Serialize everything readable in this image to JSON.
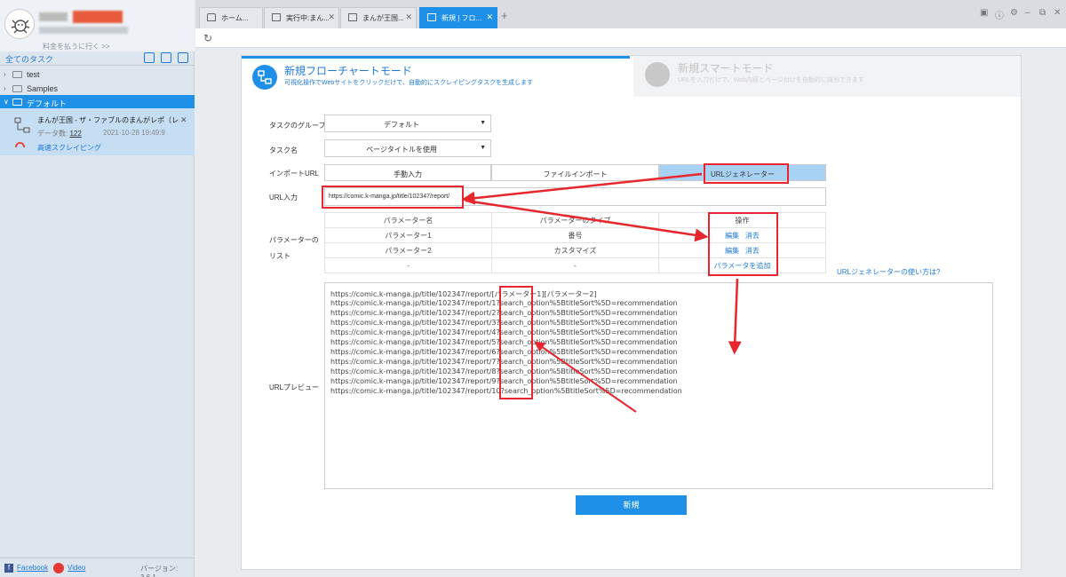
{
  "sidebar": {
    "pay_link": "料金を払うに行く >>",
    "all_tasks": "全てのタスク",
    "tree": [
      {
        "label": "test"
      },
      {
        "label": "Samples"
      },
      {
        "label": "デフォルト"
      }
    ],
    "task": {
      "title": "まんが王国 - ザ・ファブルのまんがレポ（レ...",
      "count_label": "データ数:",
      "count": "122",
      "date": "2021-10-28 19:49:9",
      "speed_label": "高速スクレイピング"
    },
    "footer": {
      "facebook": "Facebook",
      "video": "Video",
      "version": "バージョン: 3.6.1"
    }
  },
  "tabs": [
    {
      "label": "ホーム..."
    },
    {
      "label": "実行中:まん..."
    },
    {
      "label": "まんが王国..."
    },
    {
      "label": "新規 | フロ..."
    }
  ],
  "modes": {
    "flow_title": "新規フローチャートモード",
    "flow_sub": "可視化操作でWebサイトをクリックだけで、自動的にスクレイピングタスクを生成します",
    "smart_title": "新規スマートモード",
    "smart_sub": "URLを入力だけで、Web内容とページ付けを自動的に識別できます"
  },
  "form": {
    "group_label": "タスクのグループ",
    "group_value": "デフォルト",
    "name_label": "タスク名",
    "name_value": "ページタイトルを使用",
    "import_label": "インポートURL",
    "import_tabs": [
      "手動入力",
      "ファイルインポート",
      "URLジェネレーター"
    ],
    "url_label": "URL入力",
    "url_value": "https://comic.k-manga.jp/title/102347/report/",
    "param_label": "パラメーターのリスト",
    "param_headers": [
      "パラメーター名",
      "パラメーターのタイプ",
      "操作"
    ],
    "params": [
      {
        "name": "パラメーター1",
        "type": "番号",
        "edit": "編集",
        "delete": "消去"
      },
      {
        "name": "パラメーター2",
        "type": "カスタマイズ",
        "edit": "編集",
        "delete": "消去"
      }
    ],
    "empty_cell": "-",
    "add_param": "パラメータを追加",
    "help_link": "URLジェネレーターの使い方は?",
    "preview_label": "URLプレビュー",
    "preview_lines": [
      "https://comic.k-manga.jp/title/102347/report/[パラメーター1][パラメーター2]",
      "https://comic.k-manga.jp/title/102347/report/1?search_option%5BtitleSort%5D=recommendation",
      "https://comic.k-manga.jp/title/102347/report/2?search_option%5BtitleSort%5D=recommendation",
      "https://comic.k-manga.jp/title/102347/report/3?search_option%5BtitleSort%5D=recommendation",
      "https://comic.k-manga.jp/title/102347/report/4?search_option%5BtitleSort%5D=recommendation",
      "https://comic.k-manga.jp/title/102347/report/5?search_option%5BtitleSort%5D=recommendation",
      "https://comic.k-manga.jp/title/102347/report/6?search_option%5BtitleSort%5D=recommendation",
      "https://comic.k-manga.jp/title/102347/report/7?search_option%5BtitleSort%5D=recommendation",
      "https://comic.k-manga.jp/title/102347/report/8?search_option%5BtitleSort%5D=recommendation",
      "https://comic.k-manga.jp/title/102347/report/9?search_option%5BtitleSort%5D=recommendation",
      "https://comic.k-manga.jp/title/102347/report/10?search_option%5BtitleSort%5D=recommendation"
    ],
    "create_button": "新規"
  },
  "colors": {
    "accent": "#1e90e8",
    "annotation": "#e8262d"
  }
}
